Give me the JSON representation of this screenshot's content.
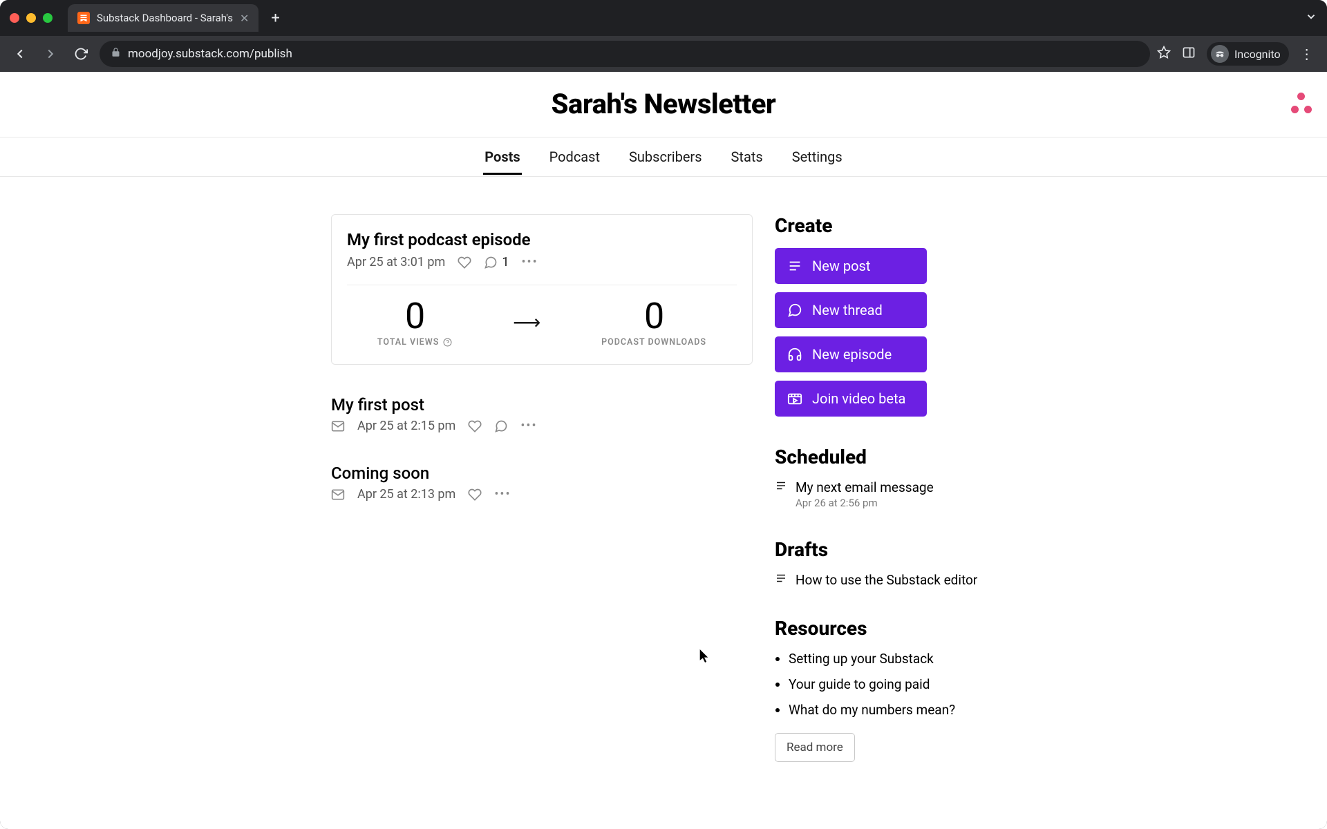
{
  "browser": {
    "tab_title": "Substack Dashboard - Sarah's",
    "url": "moodjoy.substack.com/publish",
    "incognito_label": "Incognito"
  },
  "header": {
    "site_title": "Sarah's Newsletter"
  },
  "nav": {
    "tabs": [
      "Posts",
      "Podcast",
      "Subscribers",
      "Stats",
      "Settings"
    ],
    "active_index": 0
  },
  "featured_post": {
    "title": "My first podcast episode",
    "date": "Apr 25 at 3:01 pm",
    "comment_count": "1",
    "stats": {
      "views_value": "0",
      "views_label": "TOTAL VIEWS",
      "downloads_value": "0",
      "downloads_label": "PODCAST DOWNLOADS"
    }
  },
  "posts": [
    {
      "title": "My first post",
      "date": "Apr 25 at 2:15 pm",
      "has_mail": true,
      "has_comment": true
    },
    {
      "title": "Coming soon",
      "date": "Apr 25 at 2:13 pm",
      "has_mail": true,
      "has_comment": false
    }
  ],
  "sidebar": {
    "create": {
      "heading": "Create",
      "buttons": {
        "new_post": "New post",
        "new_thread": "New thread",
        "new_episode": "New episode",
        "join_video": "Join video beta"
      }
    },
    "scheduled": {
      "heading": "Scheduled",
      "item_title": "My next email message",
      "item_date": "Apr 26 at 2:56 pm"
    },
    "drafts": {
      "heading": "Drafts",
      "item_title": "How to use the Substack editor"
    },
    "resources": {
      "heading": "Resources",
      "items": [
        "Setting up your Substack",
        "Your guide to going paid",
        "What do my numbers mean?"
      ],
      "read_more": "Read more"
    }
  }
}
